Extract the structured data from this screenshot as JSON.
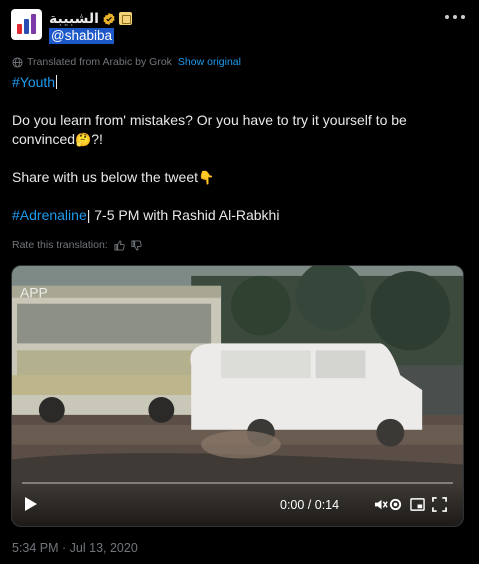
{
  "account": {
    "display_name": "الشبيبة",
    "handle": "@shabiba",
    "avatar_colors": [
      "#e02a2f",
      "#2a4db3",
      "#7b3aa8"
    ]
  },
  "translation": {
    "note": "Translated from Arabic by Grok",
    "show_original": "Show original"
  },
  "tweet": {
    "hashtag_youth": "#Youth",
    "line1": "Do you learn from' mistakes? Or you have to try it yourself to be convinced",
    "line1_suffix": "?!",
    "emoji_thinking": "🤔",
    "line2": "Share with us below the tweet",
    "emoji_point": "👇",
    "hashtag_adrenaline": "#Adrenaline",
    "line3": "| 7-5 PM with Rashid Al-Rabkhi"
  },
  "rate": {
    "label": "Rate this translation:"
  },
  "video": {
    "time": "0:00 / 0:14",
    "progress": 0.0,
    "watermark": "APP"
  },
  "timestamp": "5:34 PM · Jul 13, 2020",
  "colors": {
    "link": "#1d9bf0",
    "muted": "#71767b",
    "background": "#000000",
    "verified": "#e8b22d"
  }
}
